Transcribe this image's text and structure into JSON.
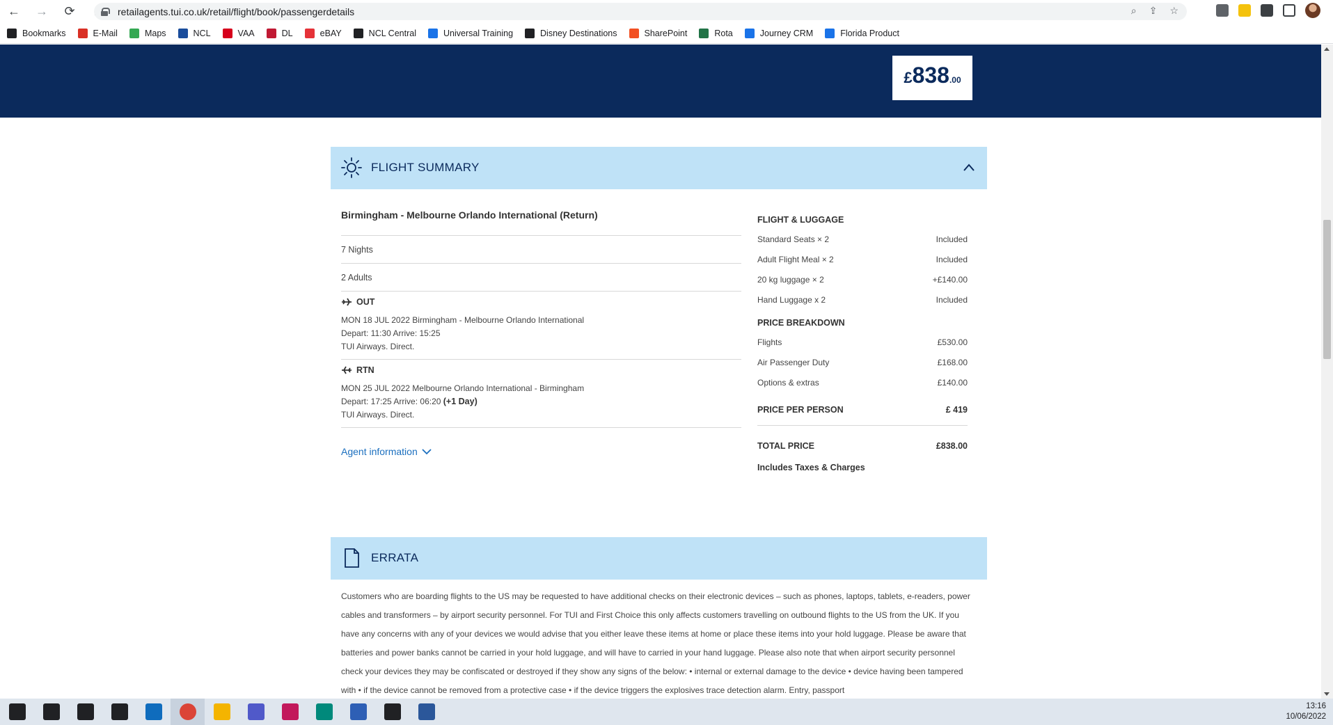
{
  "browser": {
    "url": "retailagents.tui.co.uk/retail/flight/book/passengerdetails",
    "bookmarks": [
      {
        "label": "Bookmarks",
        "icon": "star-icon",
        "color": "#202124"
      },
      {
        "label": "E-Mail",
        "icon": "gmail-icon",
        "color": "#d93025"
      },
      {
        "label": "Maps",
        "icon": "maps-icon",
        "color": "#34a853"
      },
      {
        "label": "NCL",
        "icon": "ncl-icon",
        "color": "#1a4d9c"
      },
      {
        "label": "VAA",
        "icon": "vaa-icon",
        "color": "#d6001c"
      },
      {
        "label": "DL",
        "icon": "delta-icon",
        "color": "#c01933"
      },
      {
        "label": "eBAY",
        "icon": "ebay-icon",
        "color": "#e53238"
      },
      {
        "label": "NCL Central",
        "icon": "ncl-central-icon",
        "color": "#202124"
      },
      {
        "label": "Universal Training",
        "icon": "universal-icon",
        "color": "#1a73e8"
      },
      {
        "label": "Disney Destinations",
        "icon": "disney-icon",
        "color": "#202124"
      },
      {
        "label": "SharePoint",
        "icon": "sharepoint-icon",
        "color": "#f25022"
      },
      {
        "label": "Rota",
        "icon": "excel-icon",
        "color": "#217346"
      },
      {
        "label": "Journey CRM",
        "icon": "journey-crm-icon",
        "color": "#1a73e8"
      },
      {
        "label": "Florida Product",
        "icon": "florida-icon",
        "color": "#1a73e8"
      }
    ]
  },
  "header": {
    "price_currency": "£",
    "price_main": "838",
    "price_decimals": ".00"
  },
  "flight_summary": {
    "title": "FLIGHT SUMMARY",
    "route": "Birmingham - Melbourne Orlando International (Return)",
    "nights": "7 Nights",
    "adults": "2  Adults",
    "outbound": {
      "label": "OUT",
      "line1": "MON 18 JUL 2022 Birmingham  - Melbourne Orlando International",
      "line2": "Depart: 11:30 Arrive: 15:25",
      "line3": "TUI Airways. Direct."
    },
    "return": {
      "label": "RTN",
      "line1": "MON 25 JUL 2022 Melbourne Orlando International - Birmingham",
      "line2": "Depart: 17:25 Arrive: 06:20",
      "plus_day": "(+1 Day)",
      "line3": "TUI Airways. Direct."
    },
    "agent_info": "Agent information"
  },
  "luggage": {
    "heading": "FLIGHT & LUGGAGE",
    "items": [
      {
        "label": "Standard Seats × 2",
        "value": "Included"
      },
      {
        "label": "Adult Flight Meal × 2",
        "value": "Included"
      },
      {
        "label": "20 kg luggage × 2",
        "value": "+£140.00"
      },
      {
        "label": "Hand Luggage x 2",
        "value": "Included"
      }
    ]
  },
  "breakdown": {
    "heading": "PRICE BREAKDOWN",
    "items": [
      {
        "label": "Flights",
        "value": "£530.00"
      },
      {
        "label": "Air Passenger Duty",
        "value": "£168.00"
      },
      {
        "label": "Options & extras",
        "value": "£140.00"
      }
    ],
    "per_person_label": "PRICE PER PERSON",
    "per_person_value": "£ 419",
    "total_label": "TOTAL PRICE",
    "total_value": "£838.00",
    "includes": "Includes Taxes & Charges"
  },
  "errata": {
    "title": "ERRATA",
    "text": "Customers who are boarding flights to the US may be requested to have additional checks on their electronic devices – such as phones, laptops, tablets, e-readers, power cables and transformers – by airport security personnel. For TUI and First Choice this only affects customers travelling on outbound flights to the US from the UK. If you have any concerns with any of your devices we would advise that you either leave these items at home or place these items into your hold luggage. Please be aware that batteries and power banks cannot be carried in your hold luggage, and will have to carried in your hand luggage. Please also note that when airport security personnel check your devices they may be confiscated or destroyed if they show any signs of the below: • internal or external damage to the device • device having been tampered with • if the device cannot be removed from a protective case • if the device triggers the explosives trace detection alarm. Entry, passport"
  },
  "taskbar": {
    "time": "13:16",
    "date": "10/06/2022",
    "apps": [
      {
        "name": "start-icon",
        "color": "#202124"
      },
      {
        "name": "search-icon",
        "color": "#202124"
      },
      {
        "name": "cortana-icon",
        "color": "#202124"
      },
      {
        "name": "task-view-icon",
        "color": "#202124"
      },
      {
        "name": "outlook-icon",
        "color": "#0f6cbd"
      },
      {
        "name": "chrome-icon",
        "color": "#db4437"
      },
      {
        "name": "file-explorer-icon",
        "color": "#f4b400"
      },
      {
        "name": "teams-icon",
        "color": "#5059c9"
      },
      {
        "name": "snipping-tool-icon",
        "color": "#c2185b"
      },
      {
        "name": "remote-app-icon",
        "color": "#00897b"
      },
      {
        "name": "connect-app-icon",
        "color": "#2e5fb5"
      },
      {
        "name": "tui-app-icon",
        "color": "#202124"
      },
      {
        "name": "word-icon",
        "color": "#2b579a"
      }
    ]
  }
}
